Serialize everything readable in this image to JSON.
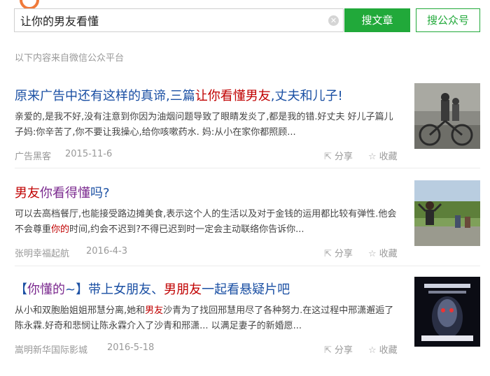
{
  "search": {
    "query": "让你的男友看懂",
    "search_articles_label": "搜文章",
    "search_accounts_label": "搜公众号"
  },
  "source_note": "以下内容来自微信公众平台",
  "results": [
    {
      "title_parts": [
        "原来广告中还有这样的真谛,三篇",
        "让你看懂男友",
        ",丈夫和儿子!"
      ],
      "summary": "亲爱的,是我不好,没有注意到你因为油烟问题导致了眼睛发炎了,都是我的错.好丈夫 好儿子篇儿子妈:你辛苦了,你不要让我操心,给你咳嗽药水. 妈:从小在家你都照顾...",
      "source": "广告黑客",
      "date": "2015-11-6",
      "share": "分享",
      "favorite": "收藏"
    },
    {
      "title_parts": [
        "男友",
        "你看得懂",
        "吗?"
      ],
      "summary_parts": [
        "可以去高档餐厅,也能接受路边摊美食,表示这个人的生活以及对于金钱的运用都比较有弹性.他会不会尊重",
        "你的",
        "时间,约会不迟到?不得已迟到时一定会主动联络你告诉你..."
      ],
      "source": "张明幸福起航",
      "date": "2016-4-3",
      "share": "分享",
      "favorite": "收藏"
    },
    {
      "title_parts": [
        "【",
        "你懂的",
        "~】带上女朋友、",
        "男朋友",
        "一起看悬疑片吧"
      ],
      "summary_parts": [
        "从小和双胞胎姐姐邢慧分离,她和",
        "男友",
        "沙青为了找回邢慧用尽了各种努力.在这过程中邢潇邂逅了陈永霖.好奇和悲悯让陈永霖介入了沙青和邢潇... 以满足妻子的新婚愿..."
      ],
      "source": "嵩明新华国际影城",
      "date": "2016-5-18",
      "share": "分享",
      "favorite": "收藏"
    }
  ]
}
